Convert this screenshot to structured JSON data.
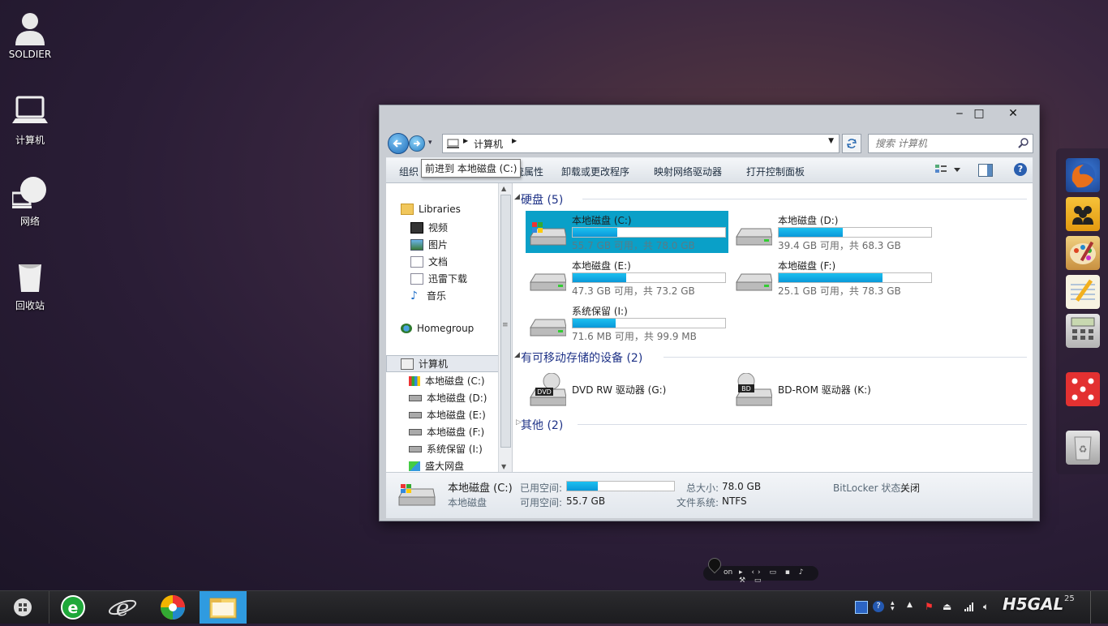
{
  "desktop": {
    "icons": [
      {
        "label": "SOLDIER",
        "icon": "user-icon"
      },
      {
        "label": "计算机",
        "icon": "computer-icon"
      },
      {
        "label": "网络",
        "icon": "network-icon"
      },
      {
        "label": "回收站",
        "icon": "recycle-bin-icon"
      }
    ]
  },
  "window": {
    "controls": {
      "minimize": "‒",
      "maximize": "□",
      "close": "✕"
    },
    "address": {
      "segments": [
        "计算机"
      ]
    },
    "search": {
      "placeholder": "搜索 计算机"
    },
    "commands": {
      "organize": "组织",
      "properties": "统属性",
      "uninstall": "卸载或更改程序",
      "map_drive": "映射网络驱动器",
      "control_panel": "打开控制面板"
    },
    "tooltip": "前进到 本地磁盘 (C:)",
    "nav": {
      "libraries": "Libraries",
      "videos": "视频",
      "pictures": "图片",
      "documents": "文档",
      "downloads": "迅雷下载",
      "music": "音乐",
      "homegroup": "Homegroup",
      "computer": "计算机",
      "drive_c": "本地磁盘 (C:)",
      "drive_d": "本地磁盘 (D:)",
      "drive_e": "本地磁盘 (E:)",
      "drive_f": "本地磁盘 (F:)",
      "drive_i": "系统保留 (I:)",
      "netdisk": "盛大网盘"
    },
    "groups": {
      "hdd": "硬盘 (5)",
      "removable": "有可移动存储的设备 (2)",
      "other": "其他 (2)"
    },
    "drives": [
      {
        "name": "本地磁盘 (C:)",
        "free": "55.7 GB 可用，共 78.0 GB",
        "used_fraction": 0.29,
        "selected": true
      },
      {
        "name": "本地磁盘 (D:)",
        "free": "39.4 GB 可用，共 68.3 GB",
        "used_fraction": 0.42,
        "selected": false
      },
      {
        "name": "本地磁盘 (E:)",
        "free": "47.3 GB 可用，共 73.2 GB",
        "used_fraction": 0.35,
        "selected": false
      },
      {
        "name": "本地磁盘 (F:)",
        "free": "25.1 GB 可用，共 78.3 GB",
        "used_fraction": 0.68,
        "selected": false
      },
      {
        "name": "系统保留 (I:)",
        "free": "71.6 MB 可用，共 99.9 MB",
        "used_fraction": 0.28,
        "selected": false
      }
    ],
    "devices": [
      {
        "name": "DVD RW 驱动器 (G:)",
        "badge": "DVD"
      },
      {
        "name": "BD-ROM 驱动器 (K:)",
        "badge": "BD"
      }
    ],
    "details": {
      "name": "本地磁盘 (C:)",
      "type": "本地磁盘",
      "used_label": "已用空间:",
      "used_fraction": 0.29,
      "free_label": "可用空间:",
      "free_value": "55.7 GB",
      "total_label": "总大小:",
      "total_value": "78.0 GB",
      "fs_label": "文件系统:",
      "fs_value": "NTFS",
      "bitlocker_label": "BitLocker 状态:",
      "bitlocker_value": "关闭"
    }
  },
  "taskbar": {
    "clock_fragment": "25",
    "logo_text": "H5GAL",
    "mini_toolbar": "on"
  },
  "colors": {
    "selection": "#0aa0c8",
    "bar_fill": "#12b0e8",
    "group_text": "#1e3287"
  }
}
